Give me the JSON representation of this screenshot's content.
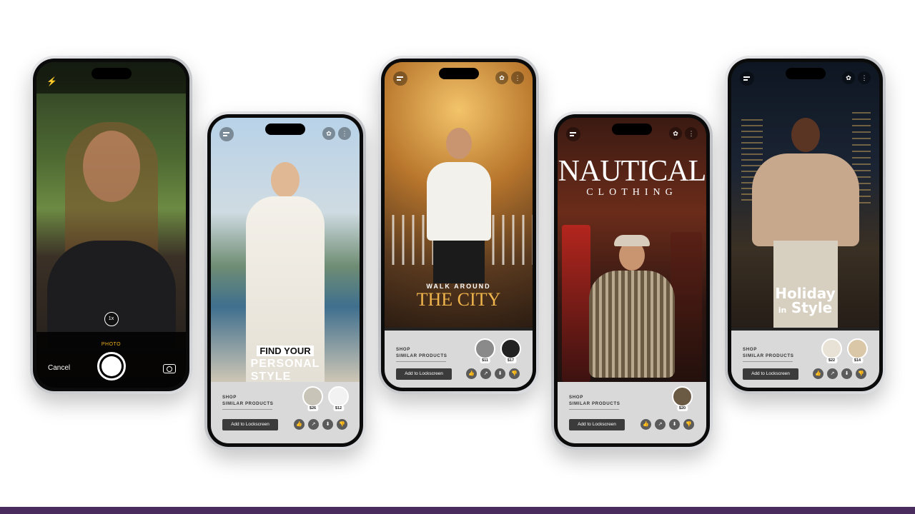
{
  "camera": {
    "mode_label": "PHOTO",
    "zoom_label": "1x",
    "cancel_label": "Cancel"
  },
  "wallpapers": [
    {
      "headline_line1": "FIND YOUR",
      "headline_line2": "PERSONAL",
      "headline_line3": "STYLE",
      "shop_label_1": "SHOP",
      "shop_label_2": "SIMILAR PRODUCTS",
      "lock_button": "Add to Lockscreen",
      "prices": [
        "$26",
        "$12"
      ]
    },
    {
      "headline_line1": "WALK AROUND",
      "headline_line2": "THE CITY",
      "shop_label_1": "SHOP",
      "shop_label_2": "SIMILAR PRODUCTS",
      "lock_button": "Add to Lockscreen",
      "prices": [
        "$11",
        "$17"
      ]
    },
    {
      "headline_line1": "NAUTICAL",
      "headline_line2": "CLOTHING",
      "shop_label_1": "SHOP",
      "shop_label_2": "SIMILAR PRODUCTS",
      "lock_button": "Add to Lockscreen",
      "prices": [
        "$20"
      ]
    },
    {
      "headline_line1": "Holiday",
      "headline_line2": "in",
      "headline_line3": "Style",
      "shop_label_1": "SHOP",
      "shop_label_2": "SIMILAR PRODUCTS",
      "lock_button": "Add to Lockscreen",
      "prices": [
        "$22",
        "$14"
      ]
    }
  ],
  "icons": {
    "like": "thumbs-up-icon",
    "share": "share-icon",
    "download": "download-icon",
    "dislike": "thumbs-down-icon"
  },
  "colors": {
    "accent_yellow": "#f1b21e",
    "panel_grey": "#d9d9d9",
    "button_dark": "#3b3b3b",
    "brand_bar": "#4a2d5e",
    "city_gold": "#f0b54c"
  }
}
